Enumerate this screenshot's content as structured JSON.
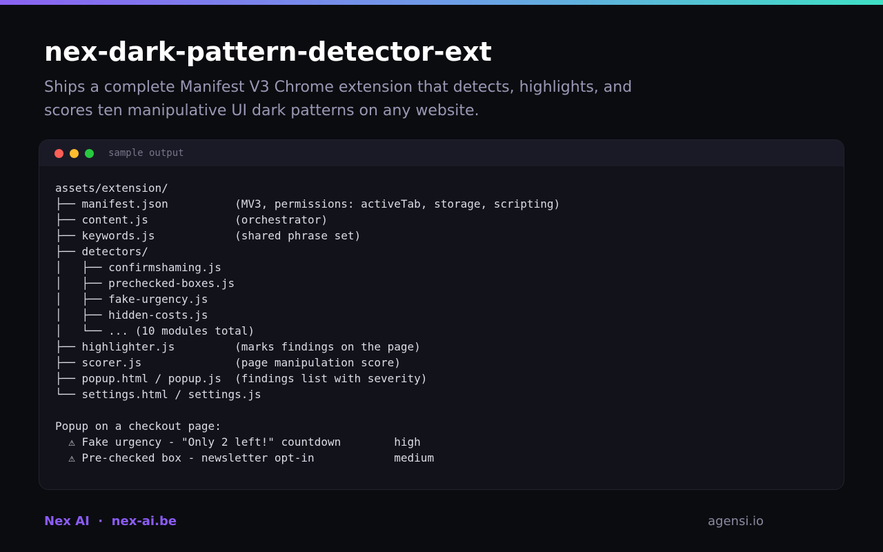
{
  "header": {
    "title": "nex-dark-pattern-detector-ext",
    "subtitle": "Ships a complete Manifest V3 Chrome extension that detects, highlights, and scores ten manipulative UI dark patterns on any website."
  },
  "terminal": {
    "label": "sample output",
    "lines": [
      "assets/extension/",
      "├── manifest.json          (MV3, permissions: activeTab, storage, scripting)",
      "├── content.js             (orchestrator)",
      "├── keywords.js            (shared phrase set)",
      "├── detectors/",
      "│   ├── confirmshaming.js",
      "│   ├── prechecked-boxes.js",
      "│   ├── fake-urgency.js",
      "│   ├── hidden-costs.js",
      "│   └── ... (10 modules total)",
      "├── highlighter.js         (marks findings on the page)",
      "├── scorer.js              (page manipulation score)",
      "├── popup.html / popup.js  (findings list with severity)",
      "└── settings.html / settings.js",
      "",
      "Popup on a checkout page:",
      "  ⚠ Fake urgency - \"Only 2 left!\" countdown        high",
      "  ⚠ Pre-checked box - newsletter opt-in            medium"
    ]
  },
  "footer": {
    "brand": "Nex AI  ·  nex-ai.be",
    "right": "agensi.io"
  },
  "colors": {
    "background": "#0b0c10",
    "accent": "#8b5cf6",
    "gradient_start": "#8a63f2",
    "gradient_end": "#3fe0c5",
    "subtitle": "#9a97b4"
  }
}
